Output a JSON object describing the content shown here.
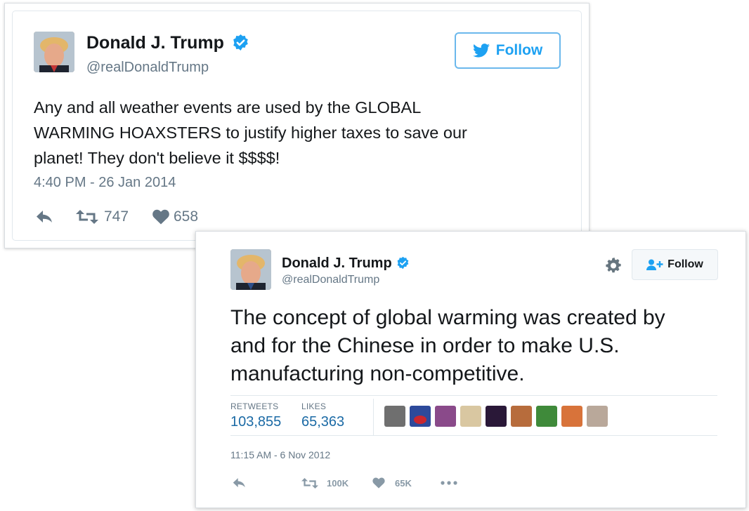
{
  "tweet1": {
    "author_name": "Donald J. Trump",
    "author_handle": "@realDonaldTrump",
    "follow_label": "Follow",
    "text": "Any and all weather events are used by the GLOBAL\nWARMING HOAXSTERS to justify higher taxes to save our\nplanet! They don't believe it $$$$!",
    "timestamp": "4:40 PM - 26 Jan 2014",
    "retweet_count": "747",
    "like_count": "658",
    "icons": [
      "verified-badge-icon",
      "twitter-bird-icon",
      "reply-icon",
      "retweet-icon",
      "heart-icon"
    ]
  },
  "tweet2": {
    "author_name": "Donald J. Trump",
    "author_handle": "@realDonaldTrump",
    "follow_label": "Follow",
    "text": "The concept of global warming was created by\nand for the Chinese in order to make U.S.\nmanufacturing non-competitive.",
    "retweets_label": "RETWEETS",
    "retweets_value": "103,855",
    "likes_label": "LIKES",
    "likes_value": "65,363",
    "timestamp": "11:15 AM - 6 Nov 2012",
    "retweet_count": "100K",
    "like_count": "65K",
    "icons": [
      "verified-badge-icon",
      "gear-icon",
      "add-user-icon",
      "reply-icon",
      "retweet-icon",
      "heart-icon",
      "more-icon"
    ]
  },
  "colors": {
    "twitter_blue": "#1da1f2",
    "link_blue": "#1b6aa5",
    "text_dark": "#14171a",
    "text_gray": "#657786",
    "border": "#e1e8ed"
  }
}
